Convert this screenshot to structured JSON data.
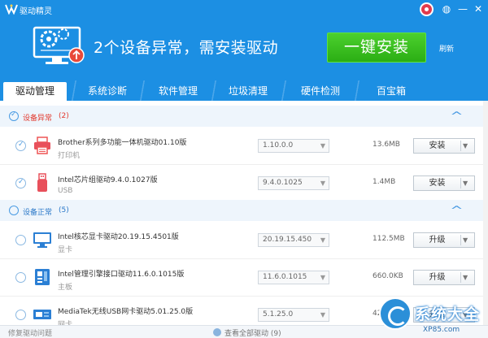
{
  "app": {
    "title": "驱动精灵"
  },
  "header": {
    "alert_message": "2个设备异常，需安装驱动",
    "install_all_label": "一键安装",
    "refresh_label": "刷新"
  },
  "tabs": [
    {
      "label": "驱动管理",
      "active": true
    },
    {
      "label": "系统诊断",
      "active": false
    },
    {
      "label": "软件管理",
      "active": false
    },
    {
      "label": "垃圾清理",
      "active": false
    },
    {
      "label": "硬件检测",
      "active": false
    },
    {
      "label": "百宝箱",
      "active": false
    }
  ],
  "sections": {
    "abnormal": {
      "title": "设备异常",
      "count": "(2)"
    },
    "normal": {
      "title": "设备正常",
      "count": "(5)"
    }
  },
  "drivers": [
    {
      "name": "Brother系列多功能一体机驱动01.10版",
      "type": "打印机",
      "version": "1.10.0.0",
      "size": "13.6MB",
      "action": "安装",
      "icon": "printer-icon"
    },
    {
      "name": "Intel芯片组驱动9.4.0.1027版",
      "type": "USB",
      "version": "9.4.0.1025",
      "size": "1.4MB",
      "action": "安装",
      "icon": "usb-icon"
    },
    {
      "name": "Intel核芯显卡驱动20.19.15.4501版",
      "type": "显卡",
      "version": "20.19.15.450",
      "size": "112.5MB",
      "action": "升级",
      "icon": "monitor-icon"
    },
    {
      "name": "Intel管理引擎接口驱动11.6.0.1015版",
      "type": "主板",
      "version": "11.6.0.1015",
      "size": "660.0KB",
      "action": "升级",
      "icon": "motherboard-icon"
    },
    {
      "name": "MediaTek无线USB网卡驱动5.01.25.0版",
      "type": "网卡",
      "version": "5.1.25.0",
      "size": "42.9MB",
      "action": "升级",
      "icon": "network-card-icon"
    }
  ],
  "footer": {
    "repair_label": "修复驱动问题",
    "view_all_label": "查看全部驱动 (9)"
  },
  "watermark": {
    "text": "系统大全",
    "sub": "XP85.com"
  },
  "colors": {
    "header_blue": "#1c8fe3",
    "install_green": "#2bae14",
    "alert_red": "#e23a2e"
  }
}
